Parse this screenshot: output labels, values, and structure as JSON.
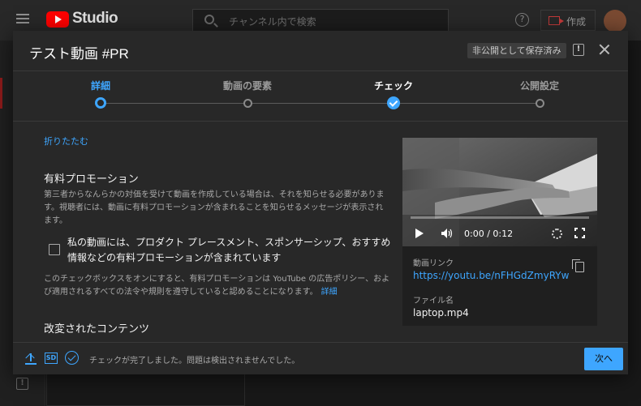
{
  "app": {
    "logo_text": "Studio",
    "search_placeholder": "チャンネル内で検索",
    "help_glyph": "?",
    "create_label": "作成"
  },
  "modal": {
    "title": "テスト動画 #PR",
    "saved_badge": "非公開として保存済み",
    "feedback_glyph": "!"
  },
  "stepper": {
    "steps": [
      {
        "label": "詳細",
        "state": "current"
      },
      {
        "label": "動画の要素",
        "state": "pending"
      },
      {
        "label": "チェック",
        "state": "done"
      },
      {
        "label": "公開設定",
        "state": "pending"
      }
    ]
  },
  "details": {
    "collapse_link": "折りたたむ",
    "paid_promo_title": "有料プロモーション",
    "paid_promo_desc": "第三者からなんらかの対価を受けて動画を作成している場合は、それを知らせる必要があります。視聴者には、動画に有料プロモーションが含まれることを知らせるメッセージが表示されます。",
    "paid_promo_checkbox_label": "私の動画には、プロダクト プレースメント、スポンサーシップ、おすすめ情報などの有料プロモーションが含まれています",
    "paid_promo_checked": false,
    "policy_note": "このチェックボックスをオンにすると、有料プロモーションは YouTube の広告ポリシー、および適用されるすべての法令や規則を遵守していると認めることになります。",
    "policy_more_link": "詳細",
    "altered_content_title": "改変されたコンテンツ"
  },
  "preview": {
    "time_display": "0:00 / 0:12",
    "video_link_label": "動画リンク",
    "video_link": "https://youtu.be/nFHGdZmyRYw",
    "file_name_label": "ファイル名",
    "file_name": "laptop.mp4"
  },
  "footer": {
    "sd_badge": "SD",
    "status_text": "チェックが完了しました。問題は検出されませんでした。",
    "next_label": "次へ"
  },
  "colors": {
    "accent": "#3ea6ff",
    "modal_bg": "#282828",
    "page_bg": "#181818",
    "brand_red": "#ff0000"
  },
  "icons": [
    "hamburger-icon",
    "youtube-logo",
    "search-icon",
    "help-icon",
    "create-camera-icon",
    "feedback-icon",
    "close-icon",
    "play-icon",
    "volume-icon",
    "settings-icon",
    "fullscreen-icon",
    "copy-icon",
    "upload-icon",
    "sd-icon",
    "check-circle-icon"
  ]
}
